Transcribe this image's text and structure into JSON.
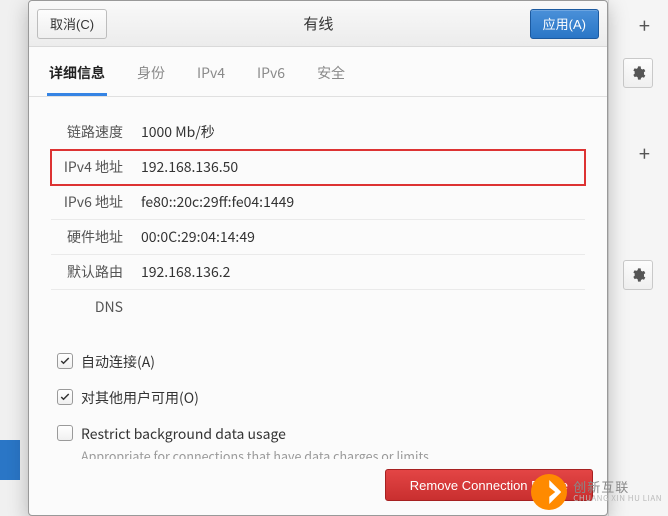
{
  "titlebar": {
    "cancel": "取消(C)",
    "title": "有线",
    "apply": "应用(A)"
  },
  "tabs": [
    "详细信息",
    "身份",
    "IPv4",
    "IPv6",
    "安全"
  ],
  "details": {
    "rows": [
      {
        "label": "链路速度",
        "value": "1000 Mb/秒"
      },
      {
        "label": "IPv4 地址",
        "value": "192.168.136.50",
        "highlight": true
      },
      {
        "label": "IPv6 地址",
        "value": "fe80::20c:29ff:fe04:1449"
      },
      {
        "label": "硬件地址",
        "value": "00:0C:29:04:14:49"
      },
      {
        "label": "默认路由",
        "value": "192.168.136.2"
      },
      {
        "label": "DNS",
        "value": ""
      }
    ]
  },
  "options": {
    "auto_connect": "自动连接(A)",
    "available_all": "对其他用户可用(O)",
    "restrict_title": "Restrict background data usage",
    "restrict_sub": "Appropriate for connections that have data charges or limits."
  },
  "footer": {
    "remove": "Remove Connection Profile"
  },
  "watermark": {
    "cn": "创新互联",
    "py": "CHUANG XIN HU LIAN"
  }
}
